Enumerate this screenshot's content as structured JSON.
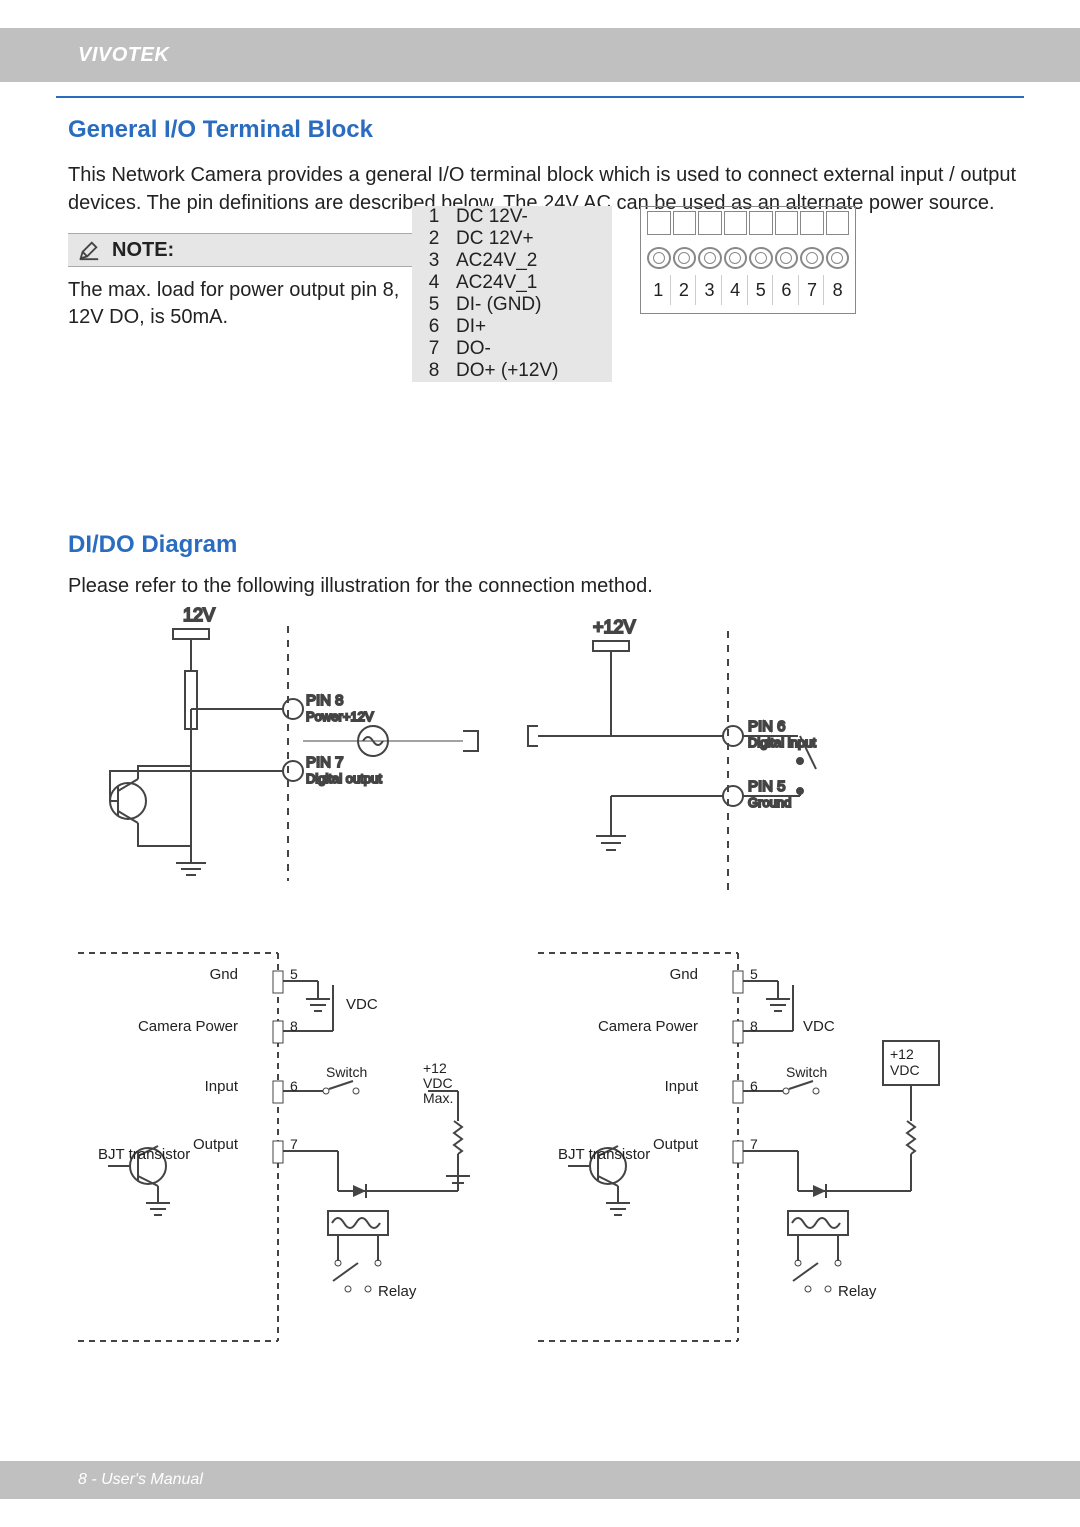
{
  "header": {
    "brand": "VIVOTEK"
  },
  "section1": {
    "title": "General I/O Terminal Block",
    "body": "This Network Camera provides a general I/O terminal block which is used to connect external input / output devices. The pin definitions are described below. The 24V AC can be used as an alternate power source.",
    "note_label": "NOTE:",
    "note_body": "The max. load for power output pin 8, 12V DO, is 50mA."
  },
  "pin_table": [
    {
      "n": "1",
      "d": "DC 12V-"
    },
    {
      "n": "2",
      "d": "DC 12V+"
    },
    {
      "n": "3",
      "d": "AC24V_2"
    },
    {
      "n": "4",
      "d": "AC24V_1"
    },
    {
      "n": "5",
      "d": "DI- (GND)"
    },
    {
      "n": "6",
      "d": "DI+"
    },
    {
      "n": "7",
      "d": "DO-"
    },
    {
      "n": "8",
      "d": "DO+ (+12V)"
    }
  ],
  "terminal_nums": [
    "1",
    "2",
    "3",
    "4",
    "5",
    "6",
    "7",
    "8"
  ],
  "section2": {
    "title": "DI/DO Diagram",
    "body": "Please refer to the following illustration for the connection method."
  },
  "diagram_upper": {
    "left": {
      "rail": "12V",
      "pin8_label": "PIN 8",
      "pin8_sub": "Power+12V",
      "pin7_label": "PIN 7",
      "pin7_sub": "Digital output"
    },
    "right": {
      "rail": "+12V",
      "pin6_label": "PIN 6",
      "pin6_sub": "Digital input",
      "pin5_label": "PIN 5",
      "pin5_sub": "Ground"
    }
  },
  "diagram_lower_labels": {
    "gnd": "Gnd",
    "camera_power": "Camera Power",
    "input": "Input",
    "output": "Output",
    "bjt": "BJT transistor",
    "vdc": "VDC",
    "switch": "Switch",
    "max12": "+12 VDC Max.",
    "v12": "+12 VDC",
    "relay": "Relay",
    "p5": "5",
    "p6": "6",
    "p7": "7",
    "p8": "8"
  },
  "footer": {
    "text": "8 - User's Manual"
  }
}
